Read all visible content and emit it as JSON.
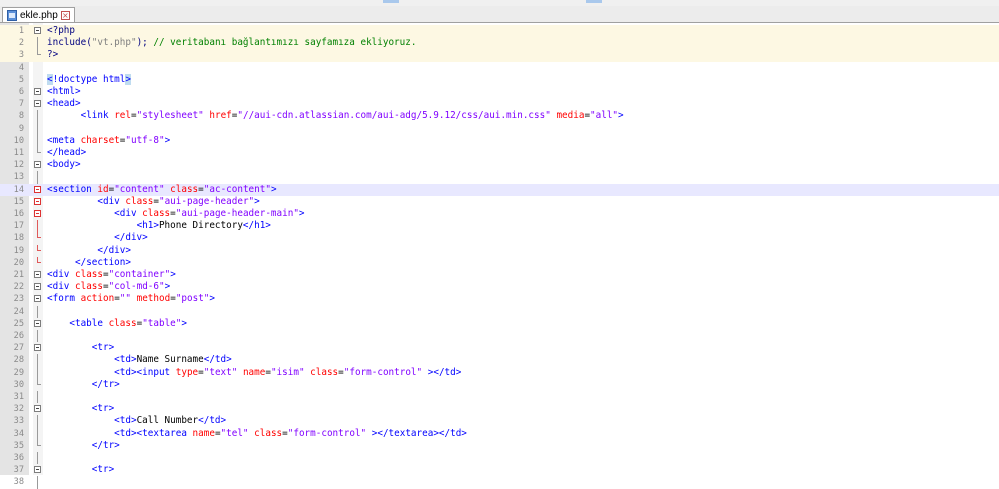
{
  "tab": {
    "label": "ekle.php"
  },
  "colors": {
    "tag": "#0000ff",
    "attribute": "#ff0000",
    "value": "#8000ff",
    "text": "#000000",
    "comment": "#008000",
    "current_line": "#e8e8ff"
  },
  "icons": {
    "file": "php-file-icon",
    "close": "close-tab-icon",
    "fold": "fold-toggle-icon"
  },
  "lines": [
    {
      "num": "1",
      "fold": "box",
      "tokens": [
        [
          "t-php",
          "<?php"
        ]
      ]
    },
    {
      "num": "2",
      "fold": "bar",
      "tokens": [
        [
          "t-php",
          "include"
        ],
        [
          "t-php",
          "("
        ],
        [
          "t-phpstr",
          "\"vt.php\""
        ],
        [
          "t-php",
          "); "
        ],
        [
          "t-com",
          "// veritabanı bağlantımızı sayfamıza ekliyoruz."
        ]
      ]
    },
    {
      "num": "3",
      "fold": "end",
      "tokens": [
        [
          "t-php",
          "?>"
        ]
      ]
    },
    {
      "num": "4",
      "fold": "",
      "tokens": []
    },
    {
      "num": "5",
      "fold": "",
      "tokens": [
        [
          "t-hl",
          "<"
        ],
        [
          "t-tag",
          "!doctype html"
        ],
        [
          "t-hl",
          ">"
        ]
      ]
    },
    {
      "num": "6",
      "fold": "box",
      "tokens": [
        [
          "t-tag",
          "<html>"
        ]
      ]
    },
    {
      "num": "7",
      "fold": "box",
      "tokens": [
        [
          "t-tag",
          "<head>"
        ]
      ]
    },
    {
      "num": "8",
      "fold": "bar",
      "tokens": [
        [
          "t-txt",
          "      "
        ],
        [
          "t-tag",
          "<link "
        ],
        [
          "t-attr",
          "rel"
        ],
        [
          "t-txt",
          "="
        ],
        [
          "t-val",
          "\"stylesheet\""
        ],
        [
          "t-txt",
          " "
        ],
        [
          "t-attr",
          "href"
        ],
        [
          "t-txt",
          "="
        ],
        [
          "t-val",
          "\"//aui-cdn.atlassian.com/aui-adg/5.9.12/css/aui.min.css\""
        ],
        [
          "t-txt",
          " "
        ],
        [
          "t-attr",
          "media"
        ],
        [
          "t-txt",
          "="
        ],
        [
          "t-val",
          "\"all\""
        ],
        [
          "t-tag",
          ">"
        ]
      ]
    },
    {
      "num": "9",
      "fold": "bar",
      "tokens": []
    },
    {
      "num": "10",
      "fold": "bar",
      "tokens": [
        [
          "t-tag",
          "<meta "
        ],
        [
          "t-attr",
          "charset"
        ],
        [
          "t-txt",
          "="
        ],
        [
          "t-val",
          "\"utf-8\""
        ],
        [
          "t-tag",
          ">"
        ]
      ]
    },
    {
      "num": "11",
      "fold": "end",
      "tokens": [
        [
          "t-tag",
          "</head>"
        ]
      ]
    },
    {
      "num": "12",
      "fold": "box",
      "tokens": [
        [
          "t-tag",
          "<body>"
        ]
      ]
    },
    {
      "num": "13",
      "fold": "bar",
      "tokens": []
    },
    {
      "num": "14",
      "fold": "boxred",
      "tokens": [
        [
          "t-tag",
          "<section "
        ],
        [
          "t-attr",
          "id"
        ],
        [
          "t-txt",
          "="
        ],
        [
          "t-val",
          "\"content\""
        ],
        [
          "t-txt",
          " "
        ],
        [
          "t-attr",
          "class"
        ],
        [
          "t-txt",
          "="
        ],
        [
          "t-val",
          "\"ac-content\""
        ],
        [
          "t-tag",
          ">"
        ]
      ]
    },
    {
      "num": "15",
      "fold": "boxred",
      "tokens": [
        [
          "t-txt",
          "         "
        ],
        [
          "t-tag",
          "<div "
        ],
        [
          "t-attr",
          "class"
        ],
        [
          "t-txt",
          "="
        ],
        [
          "t-val",
          "\"aui-page-header\""
        ],
        [
          "t-tag",
          ">"
        ]
      ]
    },
    {
      "num": "16",
      "fold": "boxred",
      "tokens": [
        [
          "t-txt",
          "            "
        ],
        [
          "t-tag",
          "<div "
        ],
        [
          "t-attr",
          "class"
        ],
        [
          "t-txt",
          "="
        ],
        [
          "t-val",
          "\"aui-page-header-main\""
        ],
        [
          "t-tag",
          ">"
        ]
      ]
    },
    {
      "num": "17",
      "fold": "barred",
      "tokens": [
        [
          "t-txt",
          "                "
        ],
        [
          "t-tag",
          "<h1>"
        ],
        [
          "t-txt",
          "Phone Directory"
        ],
        [
          "t-tag",
          "</h1>"
        ]
      ]
    },
    {
      "num": "18",
      "fold": "endred",
      "tokens": [
        [
          "t-txt",
          "            "
        ],
        [
          "t-tag",
          "</div>"
        ]
      ]
    },
    {
      "num": "19",
      "fold": "endred",
      "tokens": [
        [
          "t-txt",
          "         "
        ],
        [
          "t-tag",
          "</div>"
        ]
      ]
    },
    {
      "num": "20",
      "fold": "endred",
      "tokens": [
        [
          "t-txt",
          "     "
        ],
        [
          "t-tag",
          "</section>"
        ]
      ]
    },
    {
      "num": "21",
      "fold": "box",
      "tokens": [
        [
          "t-tag",
          "<div "
        ],
        [
          "t-attr",
          "class"
        ],
        [
          "t-txt",
          "="
        ],
        [
          "t-val",
          "\"container\""
        ],
        [
          "t-tag",
          ">"
        ]
      ]
    },
    {
      "num": "22",
      "fold": "box",
      "tokens": [
        [
          "t-tag",
          "<div "
        ],
        [
          "t-attr",
          "class"
        ],
        [
          "t-txt",
          "="
        ],
        [
          "t-val",
          "\"col-md-6\""
        ],
        [
          "t-tag",
          ">"
        ]
      ]
    },
    {
      "num": "23",
      "fold": "box",
      "tokens": [
        [
          "t-tag",
          "<form "
        ],
        [
          "t-attr",
          "action"
        ],
        [
          "t-txt",
          "="
        ],
        [
          "t-val",
          "\"\""
        ],
        [
          "t-txt",
          " "
        ],
        [
          "t-attr",
          "method"
        ],
        [
          "t-txt",
          "="
        ],
        [
          "t-val",
          "\"post\""
        ],
        [
          "t-tag",
          ">"
        ]
      ]
    },
    {
      "num": "24",
      "fold": "bar",
      "tokens": []
    },
    {
      "num": "25",
      "fold": "box",
      "tokens": [
        [
          "t-txt",
          "    "
        ],
        [
          "t-tag",
          "<table "
        ],
        [
          "t-attr",
          "class"
        ],
        [
          "t-txt",
          "="
        ],
        [
          "t-val",
          "\"table\""
        ],
        [
          "t-tag",
          ">"
        ]
      ]
    },
    {
      "num": "26",
      "fold": "bar",
      "tokens": []
    },
    {
      "num": "27",
      "fold": "box",
      "tokens": [
        [
          "t-txt",
          "        "
        ],
        [
          "t-tag",
          "<tr>"
        ]
      ]
    },
    {
      "num": "28",
      "fold": "bar",
      "tokens": [
        [
          "t-txt",
          "            "
        ],
        [
          "t-tag",
          "<td>"
        ],
        [
          "t-txt",
          "Name Surname"
        ],
        [
          "t-tag",
          "</td>"
        ]
      ]
    },
    {
      "num": "29",
      "fold": "bar",
      "tokens": [
        [
          "t-txt",
          "            "
        ],
        [
          "t-tag",
          "<td><input "
        ],
        [
          "t-attr",
          "type"
        ],
        [
          "t-txt",
          "="
        ],
        [
          "t-val",
          "\"text\""
        ],
        [
          "t-txt",
          " "
        ],
        [
          "t-attr",
          "name"
        ],
        [
          "t-txt",
          "="
        ],
        [
          "t-val",
          "\"isim\""
        ],
        [
          "t-txt",
          " "
        ],
        [
          "t-attr",
          "class"
        ],
        [
          "t-txt",
          "="
        ],
        [
          "t-val",
          "\"form-control\""
        ],
        [
          "t-txt",
          " "
        ],
        [
          "t-tag",
          "></td>"
        ]
      ]
    },
    {
      "num": "30",
      "fold": "end",
      "tokens": [
        [
          "t-txt",
          "        "
        ],
        [
          "t-tag",
          "</tr>"
        ]
      ]
    },
    {
      "num": "31",
      "fold": "bar",
      "tokens": []
    },
    {
      "num": "32",
      "fold": "box",
      "tokens": [
        [
          "t-txt",
          "        "
        ],
        [
          "t-tag",
          "<tr>"
        ]
      ]
    },
    {
      "num": "33",
      "fold": "bar",
      "tokens": [
        [
          "t-txt",
          "            "
        ],
        [
          "t-tag",
          "<td>"
        ],
        [
          "t-txt",
          "Call Number"
        ],
        [
          "t-tag",
          "</td>"
        ]
      ]
    },
    {
      "num": "34",
      "fold": "bar",
      "tokens": [
        [
          "t-txt",
          "            "
        ],
        [
          "t-tag",
          "<td><textarea "
        ],
        [
          "t-attr",
          "name"
        ],
        [
          "t-txt",
          "="
        ],
        [
          "t-val",
          "\"tel\""
        ],
        [
          "t-txt",
          " "
        ],
        [
          "t-attr",
          "class"
        ],
        [
          "t-txt",
          "="
        ],
        [
          "t-val",
          "\"form-control\""
        ],
        [
          "t-txt",
          " "
        ],
        [
          "t-tag",
          "></textarea></td>"
        ]
      ]
    },
    {
      "num": "35",
      "fold": "end",
      "tokens": [
        [
          "t-txt",
          "        "
        ],
        [
          "t-tag",
          "</tr>"
        ]
      ]
    },
    {
      "num": "36",
      "fold": "bar",
      "tokens": []
    },
    {
      "num": "37",
      "fold": "box",
      "tokens": [
        [
          "t-txt",
          "        "
        ],
        [
          "t-tag",
          "<tr>"
        ]
      ]
    },
    {
      "num": "38",
      "fold": "bar",
      "tokens": []
    }
  ]
}
